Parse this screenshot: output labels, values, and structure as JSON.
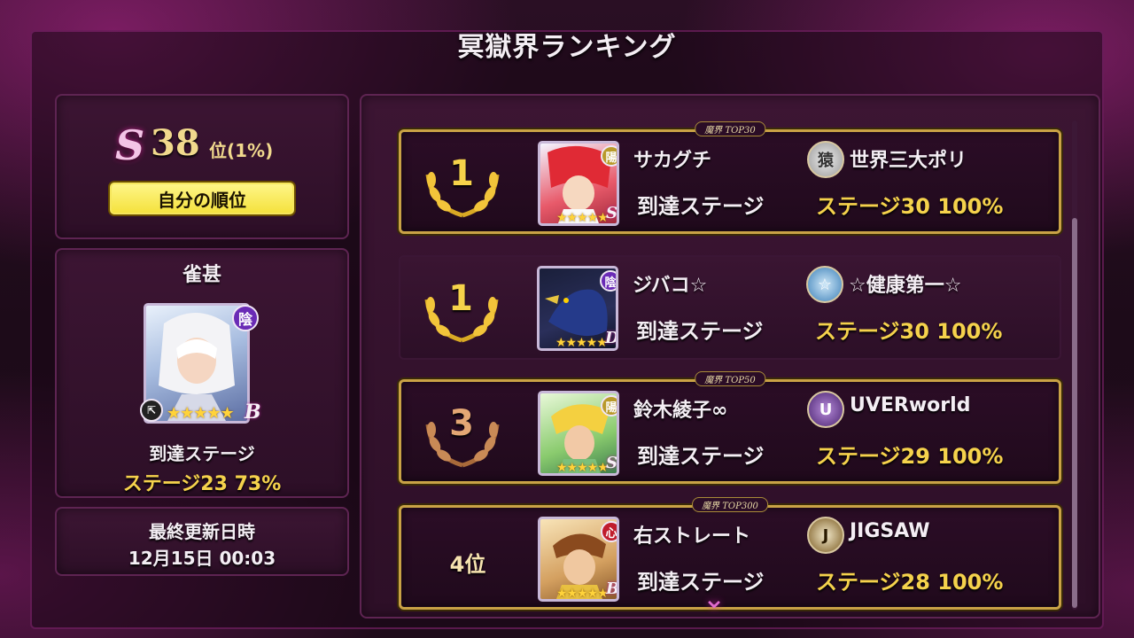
{
  "screen_title": "冥獄界ランキング",
  "my_rank": {
    "tier_letter": "S",
    "rank_number": "38",
    "rank_suffix": "位(1%)",
    "button_label": "自分の順位"
  },
  "my_character": {
    "name": "雀甚",
    "attribute_icon": "陰",
    "stars": "★★★★★",
    "grade": "B",
    "stage_label": "到達ステージ",
    "stage_value": "ステージ23 73%"
  },
  "last_update": {
    "label": "最終更新日時",
    "value": "12月15日 00:03"
  },
  "rankings": [
    {
      "rank_display": "1",
      "tag": "魔界 TOP30",
      "player_name": "サカグチ",
      "attribute_icon": "陽",
      "stars": "★★★★★",
      "grade": "S",
      "guild_icon": "猿",
      "guild_name": "世界三大ポリ",
      "stage_label": "到達ステージ",
      "stage_value": "ステージ30 100%"
    },
    {
      "rank_display": "1",
      "tag": "",
      "player_name": "ジバコ☆",
      "attribute_icon": "陰",
      "stars": "★★★★★",
      "grade": "D",
      "guild_icon": "☆",
      "guild_name": "☆健康第一☆",
      "stage_label": "到達ステージ",
      "stage_value": "ステージ30 100%"
    },
    {
      "rank_display": "3",
      "tag": "魔界 TOP50",
      "player_name": "鈴木綾子∞",
      "attribute_icon": "陽",
      "stars": "★★★★★",
      "grade": "S",
      "guild_icon": "U",
      "guild_name": "UVERworld",
      "stage_label": "到達ステージ",
      "stage_value": "ステージ29 100%"
    },
    {
      "rank_display": "4位",
      "tag": "魔界 TOP300",
      "player_name": "右ストレート",
      "attribute_icon": "心",
      "stars": "★★★★★",
      "grade": "B",
      "guild_icon": "J",
      "guild_name": "JIGSAW",
      "stage_label": "到達ステージ",
      "stage_value": "ステージ28 100%"
    }
  ],
  "colors": {
    "gold_text": "#f5d24c",
    "frame_gold": "#c9a246",
    "panel": "#3c1533",
    "accent_magenta": "#c020a0"
  }
}
